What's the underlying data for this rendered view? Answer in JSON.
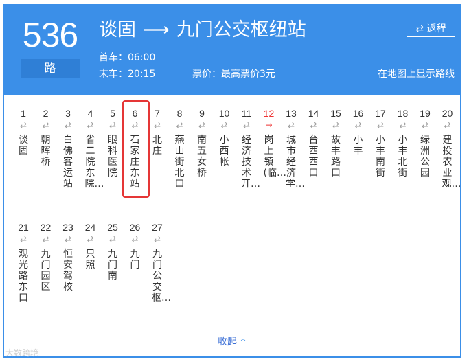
{
  "header": {
    "route_number": "536",
    "route_suffix": "路",
    "from": "谈固",
    "arrow": "⟶",
    "to": "九门公交枢纽站",
    "first_bus": "首车：06:00",
    "last_bus": "末车：20:15",
    "price": "票价：最高票价3元",
    "return_label": "⇄ 返程",
    "map_link": "在地图上显示路线"
  },
  "stops": [
    {
      "idx": "1",
      "name": "谈固"
    },
    {
      "idx": "2",
      "name": "朝晖桥"
    },
    {
      "idx": "3",
      "name": "白佛客运站"
    },
    {
      "idx": "4",
      "name": "省二院东院…"
    },
    {
      "idx": "5",
      "name": "眼科医院"
    },
    {
      "idx": "6",
      "name": "石家庄东站"
    },
    {
      "idx": "7",
      "name": "北庄"
    },
    {
      "idx": "8",
      "name": "燕山街北口"
    },
    {
      "idx": "9",
      "name": "南五女桥"
    },
    {
      "idx": "10",
      "name": "小西帐"
    },
    {
      "idx": "11",
      "name": "经济技术开…"
    },
    {
      "idx": "12",
      "name": "岗上镇(临…"
    },
    {
      "idx": "13",
      "name": "城市经济学…"
    },
    {
      "idx": "14",
      "name": "台西西口"
    },
    {
      "idx": "15",
      "name": "故丰路口"
    },
    {
      "idx": "16",
      "name": "小丰"
    },
    {
      "idx": "17",
      "name": "小丰南街"
    },
    {
      "idx": "18",
      "name": "小丰北街"
    },
    {
      "idx": "19",
      "name": "绿洲公园"
    },
    {
      "idx": "20",
      "name": "建投农业观…"
    },
    {
      "idx": "21",
      "name": "观光路东口"
    },
    {
      "idx": "22",
      "name": "九门园区"
    },
    {
      "idx": "23",
      "name": "恒安驾校"
    },
    {
      "idx": "24",
      "name": "只照"
    },
    {
      "idx": "25",
      "name": "九门南"
    },
    {
      "idx": "26",
      "name": "九门"
    },
    {
      "idx": "27",
      "name": "九门公交枢…"
    }
  ],
  "direction_symbol": "⇄",
  "direction_symbol_oneway": "→",
  "oneway_stop_index": "12",
  "collapse_label": "收起",
  "collapse_icon": "^",
  "watermark": "大数跨境",
  "colors": {
    "header_bg": "#3b8fe8",
    "highlight": "#e53636",
    "link": "#3b6fd6"
  }
}
